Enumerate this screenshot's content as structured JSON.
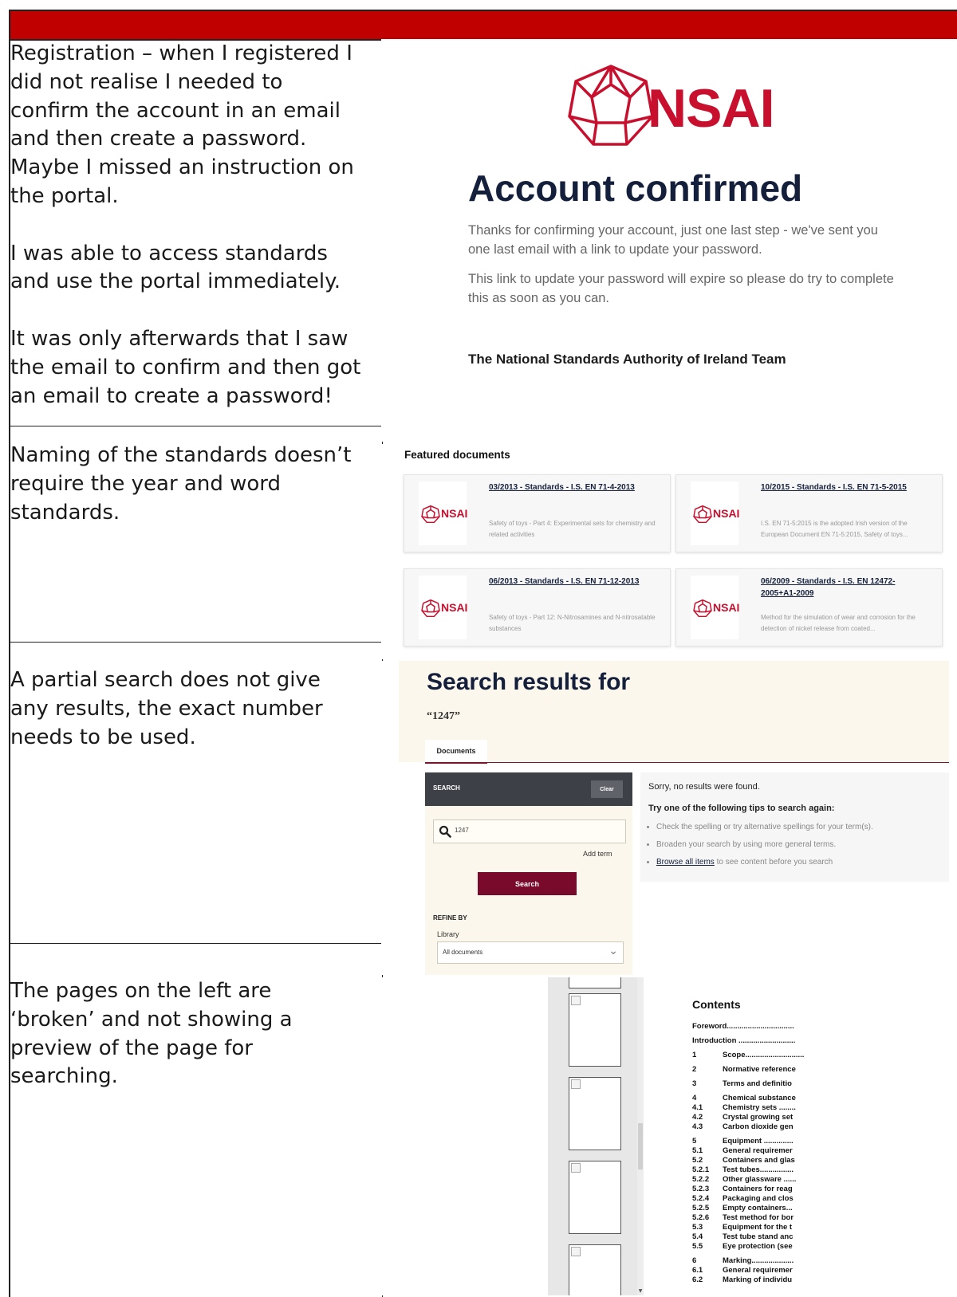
{
  "rows": [
    {
      "text": [
        "Registration – when I registered I did not realise I needed to confirm the account in an email and then create a password. Maybe I missed an instruction on the portal.",
        "I was able to access standards and use the portal immediately.",
        "It was only afterwards that I saw the email to confirm and then got an email to create a password!"
      ]
    },
    {
      "text": [
        "Naming of the standards doesn’t require the year and word standards."
      ]
    },
    {
      "text": [
        "A partial search does not give any results, the exact number needs to be used."
      ]
    },
    {
      "text": [
        "The pages on the left are ‘broken’ and not showing a preview of the page for searching."
      ]
    }
  ],
  "confirm_panel": {
    "logo_text": "NSAI",
    "title": "Account confirmed",
    "para1": "Thanks for confirming your account, just one last step - we've sent you one last email with a link to update your password.",
    "para2": "This link to update your password will expire so please do try to complete this as soon as you can.",
    "signature": "The National Standards Authority of Ireland Team",
    "brand_color": "#c8102e"
  },
  "featured": {
    "title": "Featured documents",
    "logo_text": "NSAI",
    "cards": [
      {
        "link": "03/2013 - Standards - I.S. EN 71-4-2013",
        "desc": "Safety of toys - Part 4: Experimental sets for chemistry and related activities"
      },
      {
        "link": "10/2015 - Standards - I.S. EN 71-5-2015",
        "desc": "I.S. EN 71-5:2015 is the adopted Irish version of the European Document EN 71-5:2015, Safety of toys..."
      },
      {
        "link": "06/2013 - Standards - I.S. EN 71-12-2013",
        "desc": "Safety of toys - Part 12: N-Nitrosamines and N-nitrosatable substances"
      },
      {
        "link": "06/2009 - Standards - I.S. EN 12472-2005+A1-2009",
        "desc": "Method for the simulation of wear and corrosion for the detection of nickel release from coated..."
      }
    ]
  },
  "search": {
    "title": "Search results for",
    "query": "“1247”",
    "tab": "Documents",
    "side_label": "SEARCH",
    "clear": "Clear",
    "input_value": "1247",
    "add_term": "Add term",
    "button": "Search",
    "refine": "REFINE BY",
    "library_label": "Library",
    "library_value": "All documents",
    "no_results": "Sorry, no results were found.",
    "tips_title": "Try one of the following tips to search again:",
    "tip1": "Check the spelling or try alternative spellings for your term(s).",
    "tip2": "Broaden your search by using more general terms.",
    "tip3_link": "Browse all items",
    "tip3_rest": " to see content before you search",
    "accent": "#7a0a2c"
  },
  "viewer": {
    "contents_title": "Contents",
    "toc": [
      {
        "num": "",
        "label": "Foreword................................"
      },
      {
        "num": "",
        "label": "Introduction ..........................."
      },
      {
        "num": "1",
        "label": "Scope............................"
      },
      {
        "num": "2",
        "label": "Normative reference"
      },
      {
        "num": "3",
        "label": "Terms and definitio"
      },
      {
        "num": "4",
        "label": "Chemical substance"
      },
      {
        "num": "4.1",
        "label": "Chemistry sets ........"
      },
      {
        "num": "4.2",
        "label": "Crystal growing set"
      },
      {
        "num": "4.3",
        "label": "Carbon dioxide gen"
      },
      {
        "num": "5",
        "label": "Equipment .............."
      },
      {
        "num": "5.1",
        "label": "General requiremer"
      },
      {
        "num": "5.2",
        "label": "Containers and glas"
      },
      {
        "num": "5.2.1",
        "label": "Test tubes................"
      },
      {
        "num": "5.2.2",
        "label": "Other glassware ......"
      },
      {
        "num": "5.2.3",
        "label": "Containers for reag"
      },
      {
        "num": "5.2.4",
        "label": "Packaging and clos"
      },
      {
        "num": "5.2.5",
        "label": "Empty containers..."
      },
      {
        "num": "5.2.6",
        "label": "Test method for bor"
      },
      {
        "num": "5.3",
        "label": "Equipment for the t"
      },
      {
        "num": "5.4",
        "label": "Test tube stand anc"
      },
      {
        "num": "5.5",
        "label": "Eye protection (see"
      },
      {
        "num": "6",
        "label": "Marking...................."
      },
      {
        "num": "6.1",
        "label": "General requiremer"
      },
      {
        "num": "6.2",
        "label": "Marking of individu"
      }
    ]
  }
}
